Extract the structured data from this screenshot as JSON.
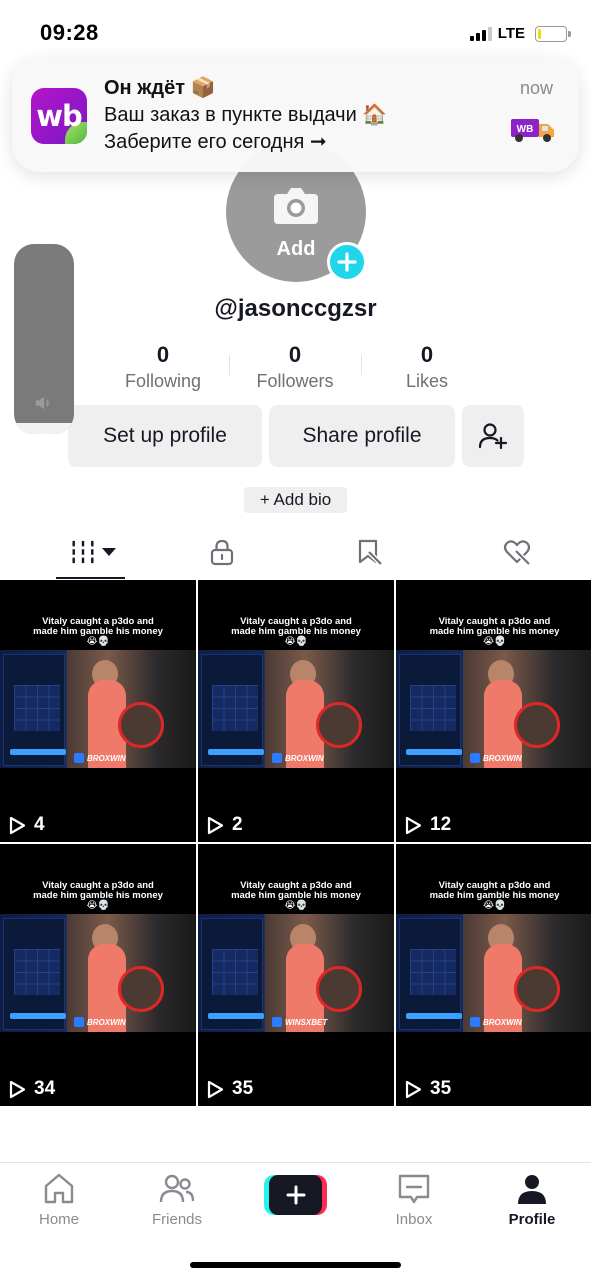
{
  "status_bar": {
    "time": "09:28",
    "network": "LTE",
    "signal_bars_active": 3,
    "signal_bars_total": 4,
    "battery_level_percent": 10,
    "battery_color": "#f5d90a"
  },
  "notification": {
    "app_logo_text": "wb",
    "title": "Он ждёт 📦",
    "line1": "Ваш заказ в пункте выдачи 🏠",
    "line2": "Заберите его сегодня ➞",
    "time": "now",
    "brand_color": "#b316c9",
    "truck_label": "WB"
  },
  "volume_hud": {
    "level_percent": 6
  },
  "profile": {
    "avatar_add_label": "Add",
    "username": "@jasonccgzsr",
    "stats": [
      {
        "value": "0",
        "label": "Following"
      },
      {
        "value": "0",
        "label": "Followers"
      },
      {
        "value": "0",
        "label": "Likes"
      }
    ],
    "setup_button": "Set up profile",
    "share_button": "Share profile",
    "add_bio": "+ Add bio",
    "accent_color": "#20d5ec"
  },
  "tabs": [
    {
      "name": "videos-grid-icon",
      "active": true
    },
    {
      "name": "lock-icon",
      "active": false
    },
    {
      "name": "saved-icon",
      "active": false
    },
    {
      "name": "liked-icon",
      "active": false
    }
  ],
  "videos": [
    {
      "caption": "Vitaly caught a p3do and made him gamble his money😭💀",
      "brand": "BROXWIN",
      "views": "4"
    },
    {
      "caption": "Vitaly caught a p3do and made him gamble his money😭💀",
      "brand": "BROXWIN",
      "views": "2"
    },
    {
      "caption": "Vitaly caught a p3do and made him gamble his money😭💀",
      "brand": "BROXWIN",
      "views": "12"
    },
    {
      "caption": "Vitaly caught a p3do and made him gamble his money😭💀",
      "brand": "BROXWIN",
      "views": "34"
    },
    {
      "caption": "Vitaly caught a p3do and made him gamble his money😭💀",
      "brand": "WINSXBET",
      "views": "35"
    },
    {
      "caption": "Vitaly caught a p3do and made him gamble his money😭💀",
      "brand": "BROXWIN",
      "views": "35"
    }
  ],
  "bottom_nav": {
    "home": "Home",
    "friends": "Friends",
    "inbox": "Inbox",
    "profile": "Profile",
    "create_colors": [
      "#25f4ee",
      "#fe2c55",
      "#161823"
    ]
  }
}
